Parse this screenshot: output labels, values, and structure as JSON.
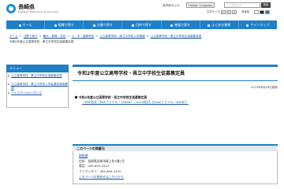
{
  "header": {
    "logo_title": "長崎県",
    "logo_sub": "Nagasaki Prefectural Government",
    "voice_label": "音声読み上げ",
    "lang_label": "Foreign Language",
    "search_placeholder": "ご入力下さい",
    "search_button": "検索",
    "textsize_label": "文字サイズ",
    "fs_buttons": [
      "小",
      "中",
      "大"
    ],
    "bg_label": "背景色"
  },
  "nav": {
    "items": [
      {
        "label": "ホーム"
      },
      {
        "label": "組織で探す"
      },
      {
        "label": "分類で探す"
      },
      {
        "label": "目的で探す"
      },
      {
        "label": "地図で探す"
      },
      {
        "label": "よくある質問"
      },
      {
        "label": "サイトマップ"
      }
    ]
  },
  "breadcrumb": {
    "items": [
      "ホーム",
      "分野で探す",
      "観光・教育・文化",
      "小・中・高等学校",
      "公立高等学校・県立中学校入学情報",
      "公立高等学校・県立中学校生徒募集定員"
    ],
    "current": "令和2年度公立高等学校・県立中学校生徒募集定員"
  },
  "sidebar": {
    "heading": "メニュー",
    "links": [
      "公立高等学校・県立中学校生徒募集定員",
      "公立高等学校・県立中学校入学者選抜実施要項",
      "ハイスクールガイダンス"
    ]
  },
  "content": {
    "title": "令和2年度公立高等学校・県立中学校生徒募集定員",
    "updated": "2019年8月18日更新",
    "doc_title": "令和2年度公立高等学校・県立中学校生徒募集定員",
    "doc_pdf_link": "（PDF形式［PDFファイル／155KB］，",
    "doc_excel_link": "Excel形式［Excelファイル／61KB］）"
  },
  "contact": {
    "heading": "このページの掲載元",
    "dept": "総務課",
    "address": "住所：長崎県長崎市尾上町3番1号",
    "tel": "電話：095-894-3312",
    "fax": "ファクシミリ：095-894-3470",
    "inquiry": "このページの問合せはこちらから"
  },
  "colors": {
    "accent": "#1f7fc9",
    "link": "#1a55a8"
  }
}
